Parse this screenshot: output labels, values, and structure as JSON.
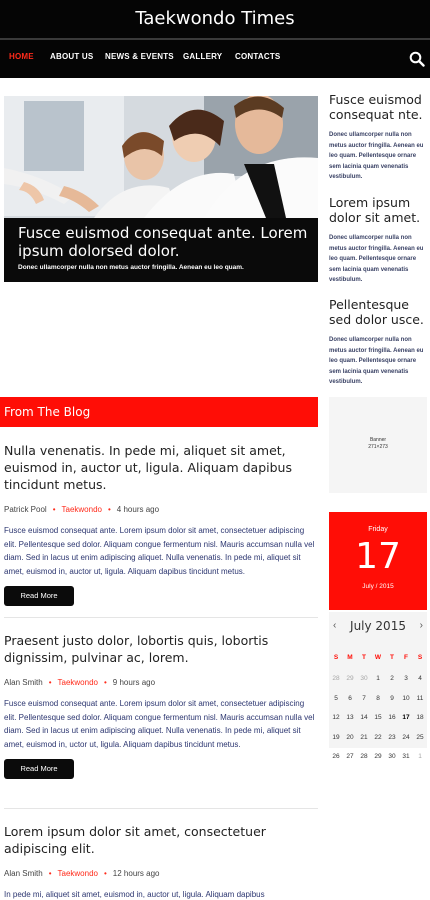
{
  "header": {
    "title": "Taekwondo Times"
  },
  "nav": {
    "items": [
      "HOME",
      "ABOUT US",
      "NEWS & EVENTS",
      "GALLERY",
      "CONTACTS"
    ],
    "active_index": 0
  },
  "hero": {
    "title": "Fusce euismod consequat ante. Lorem ipsum dolorsed dolor.",
    "text": "Donec ullamcorper nulla non metus auctor fringilla. Aenean eu leo quam."
  },
  "sidebar_posts": [
    {
      "title": "Fusce euismod consequat nte.",
      "text": "Donec ullamcorper nulla non metus auctor fringilla. Aenean eu leo quam. Pellentesque ornare sem lacinia quam venenatis vestibulum."
    },
    {
      "title": "Lorem ipsum dolor sit amet.",
      "text": "Donec ullamcorper nulla non metus auctor fringilla. Aenean eu leo quam. Pellentesque ornare sem lacinia quam venenatis vestibulum."
    },
    {
      "title": "Pellentesque sed dolor usce.",
      "text": "Donec ullamcorper nulla non metus auctor fringilla. Aenean eu leo quam. Pellentesque ornare sem lacinia quam venenatis vestibulum."
    }
  ],
  "blog": {
    "header": "From The Blog",
    "read_more_label": "Read More",
    "posts": [
      {
        "title": "Nulla venenatis. In pede mi, aliquet sit amet, euismod in, auctor ut, ligula. Aliquam dapibus tincidunt metus.",
        "author": "Patrick Pool",
        "category": "Taekwondo",
        "time": "4 hours ago",
        "excerpt": "Fusce euismod consequat ante. Lorem ipsum dolor sit amet, consectetuer adipiscing elit. Pellentesque sed dolor. Aliquam congue fermentum nisl. Mauris accumsan nulla vel diam. Sed in lacus ut enim adipiscing aliquet. Nulla venenatis. In pede mi, aliquet sit amet, euismod in, auctor ut, ligula. Aliquam dapibus tincidunt metus."
      },
      {
        "title": "Praesent justo dolor, lobortis quis, lobortis dignissim, pulvinar ac, lorem.",
        "author": "Alan Smith",
        "category": "Taekwondo",
        "time": "9 hours ago",
        "excerpt": "Fusce euismod consequat ante. Lorem ipsum dolor sit amet, consectetuer adipiscing elit. Pellentesque sed dolor. Aliquam congue fermentum nisl. Mauris accumsan nulla vel diam. Sed in lacus ut enim adipiscing aliquet. Nulla venenatis. In pede mi, aliquet sit amet, euismod in, uctor ut, ligula. Aliquam dapibus tincidunt metus."
      },
      {
        "title": "Lorem ipsum dolor sit amet, consectetuer adipiscing elit.",
        "author": "Alan Smith",
        "category": "Taekwondo",
        "time": "12 hours ago",
        "excerpt": "In pede mi, aliquet sit amet, euismod in, auctor ut, ligula. Aliquam dapibus"
      }
    ]
  },
  "banner": {
    "label": "Banner",
    "size": "271×273"
  },
  "date_box": {
    "weekday": "Friday",
    "day": "17",
    "month_year": "July / 2015"
  },
  "calendar": {
    "month_label": "July 2015",
    "prev": "‹",
    "next": "›",
    "weekdays": [
      "S",
      "M",
      "T",
      "W",
      "T",
      "F",
      "S"
    ],
    "weeks": [
      [
        "28",
        "29",
        "30",
        "1",
        "2",
        "3",
        "4"
      ],
      [
        "5",
        "6",
        "7",
        "8",
        "9",
        "10",
        "11"
      ],
      [
        "12",
        "13",
        "14",
        "15",
        "16",
        "17",
        "18"
      ],
      [
        "19",
        "20",
        "21",
        "22",
        "23",
        "24",
        "25"
      ],
      [
        "26",
        "27",
        "28",
        "29",
        "30",
        "31",
        "1"
      ]
    ],
    "today": "17"
  },
  "colors": {
    "accent": "#ff0d06",
    "dark": "#050505",
    "excerpt": "#2c3670"
  }
}
